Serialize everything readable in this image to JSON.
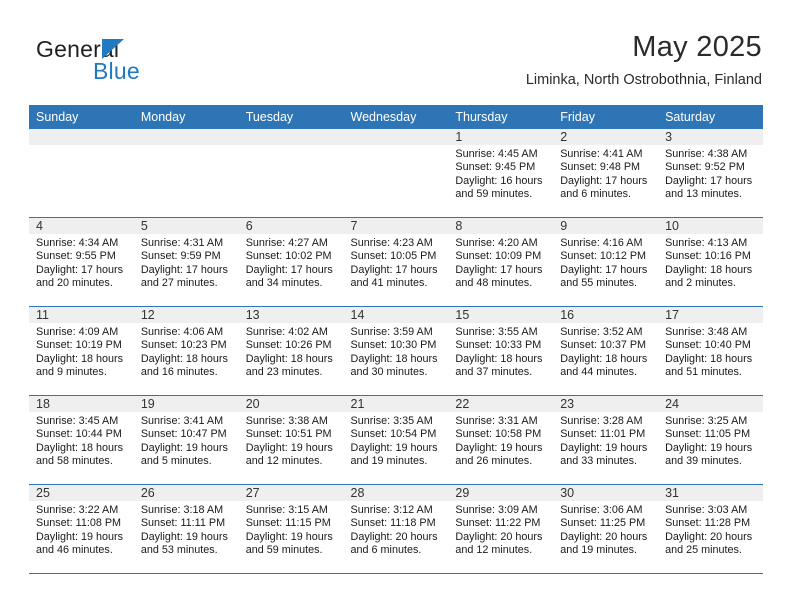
{
  "brand": {
    "name_top": "General",
    "name_bottom": "Blue",
    "triangle_icon": "triangle-icon",
    "accent_color": "#1f7ac0"
  },
  "header": {
    "month_title": "May 2025",
    "location": "Liminka, North Ostrobothnia, Finland"
  },
  "theme": {
    "header_blue": "#2e75b6",
    "band_gray": "#efefef",
    "text_color": "#1a1a1a"
  },
  "weekdays": [
    "Sunday",
    "Monday",
    "Tuesday",
    "Wednesday",
    "Thursday",
    "Friday",
    "Saturday"
  ],
  "weeks": [
    [
      {
        "day": "",
        "empty": true
      },
      {
        "day": "",
        "empty": true
      },
      {
        "day": "",
        "empty": true
      },
      {
        "day": "",
        "empty": true
      },
      {
        "day": "1",
        "sunrise": "Sunrise: 4:45 AM",
        "sunset": "Sunset: 9:45 PM",
        "daylight_1": "Daylight: 16 hours",
        "daylight_2": "and 59 minutes."
      },
      {
        "day": "2",
        "sunrise": "Sunrise: 4:41 AM",
        "sunset": "Sunset: 9:48 PM",
        "daylight_1": "Daylight: 17 hours",
        "daylight_2": "and 6 minutes."
      },
      {
        "day": "3",
        "sunrise": "Sunrise: 4:38 AM",
        "sunset": "Sunset: 9:52 PM",
        "daylight_1": "Daylight: 17 hours",
        "daylight_2": "and 13 minutes."
      }
    ],
    [
      {
        "day": "4",
        "sunrise": "Sunrise: 4:34 AM",
        "sunset": "Sunset: 9:55 PM",
        "daylight_1": "Daylight: 17 hours",
        "daylight_2": "and 20 minutes."
      },
      {
        "day": "5",
        "sunrise": "Sunrise: 4:31 AM",
        "sunset": "Sunset: 9:59 PM",
        "daylight_1": "Daylight: 17 hours",
        "daylight_2": "and 27 minutes."
      },
      {
        "day": "6",
        "sunrise": "Sunrise: 4:27 AM",
        "sunset": "Sunset: 10:02 PM",
        "daylight_1": "Daylight: 17 hours",
        "daylight_2": "and 34 minutes."
      },
      {
        "day": "7",
        "sunrise": "Sunrise: 4:23 AM",
        "sunset": "Sunset: 10:05 PM",
        "daylight_1": "Daylight: 17 hours",
        "daylight_2": "and 41 minutes."
      },
      {
        "day": "8",
        "sunrise": "Sunrise: 4:20 AM",
        "sunset": "Sunset: 10:09 PM",
        "daylight_1": "Daylight: 17 hours",
        "daylight_2": "and 48 minutes."
      },
      {
        "day": "9",
        "sunrise": "Sunrise: 4:16 AM",
        "sunset": "Sunset: 10:12 PM",
        "daylight_1": "Daylight: 17 hours",
        "daylight_2": "and 55 minutes."
      },
      {
        "day": "10",
        "sunrise": "Sunrise: 4:13 AM",
        "sunset": "Sunset: 10:16 PM",
        "daylight_1": "Daylight: 18 hours",
        "daylight_2": "and 2 minutes."
      }
    ],
    [
      {
        "day": "11",
        "sunrise": "Sunrise: 4:09 AM",
        "sunset": "Sunset: 10:19 PM",
        "daylight_1": "Daylight: 18 hours",
        "daylight_2": "and 9 minutes."
      },
      {
        "day": "12",
        "sunrise": "Sunrise: 4:06 AM",
        "sunset": "Sunset: 10:23 PM",
        "daylight_1": "Daylight: 18 hours",
        "daylight_2": "and 16 minutes."
      },
      {
        "day": "13",
        "sunrise": "Sunrise: 4:02 AM",
        "sunset": "Sunset: 10:26 PM",
        "daylight_1": "Daylight: 18 hours",
        "daylight_2": "and 23 minutes."
      },
      {
        "day": "14",
        "sunrise": "Sunrise: 3:59 AM",
        "sunset": "Sunset: 10:30 PM",
        "daylight_1": "Daylight: 18 hours",
        "daylight_2": "and 30 minutes."
      },
      {
        "day": "15",
        "sunrise": "Sunrise: 3:55 AM",
        "sunset": "Sunset: 10:33 PM",
        "daylight_1": "Daylight: 18 hours",
        "daylight_2": "and 37 minutes."
      },
      {
        "day": "16",
        "sunrise": "Sunrise: 3:52 AM",
        "sunset": "Sunset: 10:37 PM",
        "daylight_1": "Daylight: 18 hours",
        "daylight_2": "and 44 minutes."
      },
      {
        "day": "17",
        "sunrise": "Sunrise: 3:48 AM",
        "sunset": "Sunset: 10:40 PM",
        "daylight_1": "Daylight: 18 hours",
        "daylight_2": "and 51 minutes."
      }
    ],
    [
      {
        "day": "18",
        "sunrise": "Sunrise: 3:45 AM",
        "sunset": "Sunset: 10:44 PM",
        "daylight_1": "Daylight: 18 hours",
        "daylight_2": "and 58 minutes."
      },
      {
        "day": "19",
        "sunrise": "Sunrise: 3:41 AM",
        "sunset": "Sunset: 10:47 PM",
        "daylight_1": "Daylight: 19 hours",
        "daylight_2": "and 5 minutes."
      },
      {
        "day": "20",
        "sunrise": "Sunrise: 3:38 AM",
        "sunset": "Sunset: 10:51 PM",
        "daylight_1": "Daylight: 19 hours",
        "daylight_2": "and 12 minutes."
      },
      {
        "day": "21",
        "sunrise": "Sunrise: 3:35 AM",
        "sunset": "Sunset: 10:54 PM",
        "daylight_1": "Daylight: 19 hours",
        "daylight_2": "and 19 minutes."
      },
      {
        "day": "22",
        "sunrise": "Sunrise: 3:31 AM",
        "sunset": "Sunset: 10:58 PM",
        "daylight_1": "Daylight: 19 hours",
        "daylight_2": "and 26 minutes."
      },
      {
        "day": "23",
        "sunrise": "Sunrise: 3:28 AM",
        "sunset": "Sunset: 11:01 PM",
        "daylight_1": "Daylight: 19 hours",
        "daylight_2": "and 33 minutes."
      },
      {
        "day": "24",
        "sunrise": "Sunrise: 3:25 AM",
        "sunset": "Sunset: 11:05 PM",
        "daylight_1": "Daylight: 19 hours",
        "daylight_2": "and 39 minutes."
      }
    ],
    [
      {
        "day": "25",
        "sunrise": "Sunrise: 3:22 AM",
        "sunset": "Sunset: 11:08 PM",
        "daylight_1": "Daylight: 19 hours",
        "daylight_2": "and 46 minutes."
      },
      {
        "day": "26",
        "sunrise": "Sunrise: 3:18 AM",
        "sunset": "Sunset: 11:11 PM",
        "daylight_1": "Daylight: 19 hours",
        "daylight_2": "and 53 minutes."
      },
      {
        "day": "27",
        "sunrise": "Sunrise: 3:15 AM",
        "sunset": "Sunset: 11:15 PM",
        "daylight_1": "Daylight: 19 hours",
        "daylight_2": "and 59 minutes."
      },
      {
        "day": "28",
        "sunrise": "Sunrise: 3:12 AM",
        "sunset": "Sunset: 11:18 PM",
        "daylight_1": "Daylight: 20 hours",
        "daylight_2": "and 6 minutes."
      },
      {
        "day": "29",
        "sunrise": "Sunrise: 3:09 AM",
        "sunset": "Sunset: 11:22 PM",
        "daylight_1": "Daylight: 20 hours",
        "daylight_2": "and 12 minutes."
      },
      {
        "day": "30",
        "sunrise": "Sunrise: 3:06 AM",
        "sunset": "Sunset: 11:25 PM",
        "daylight_1": "Daylight: 20 hours",
        "daylight_2": "and 19 minutes."
      },
      {
        "day": "31",
        "sunrise": "Sunrise: 3:03 AM",
        "sunset": "Sunset: 11:28 PM",
        "daylight_1": "Daylight: 20 hours",
        "daylight_2": "and 25 minutes."
      }
    ]
  ]
}
